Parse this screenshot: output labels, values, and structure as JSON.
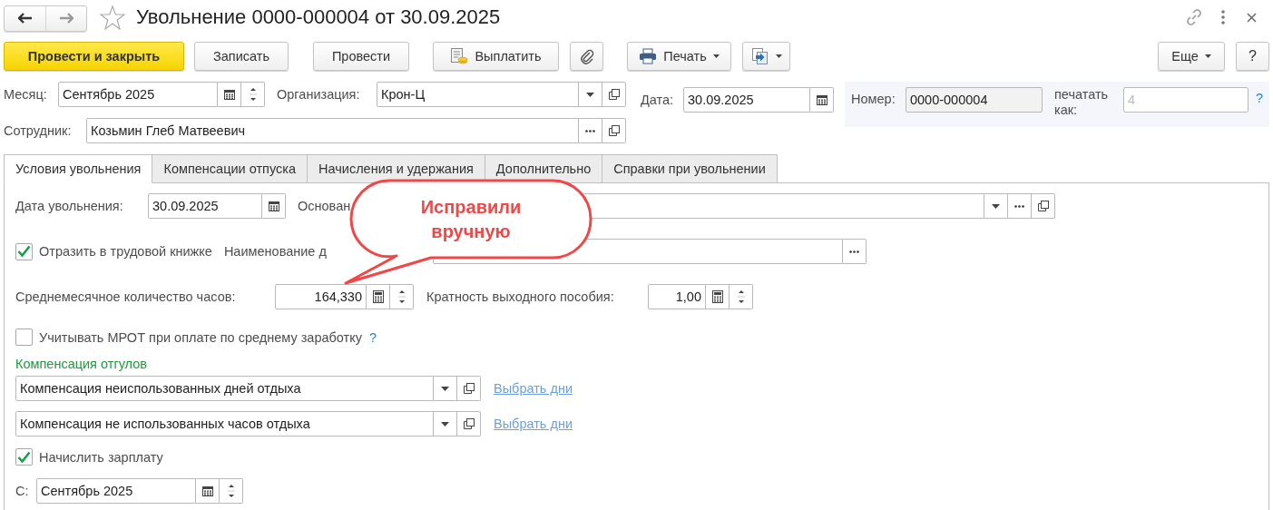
{
  "title": "Увольнение 0000-000004 от 30.09.2025",
  "toolbar_left": [
    {
      "kind": "primary",
      "label": "Провести и закрыть",
      "dropdown": false
    },
    {
      "kind": "text",
      "label": "Записать",
      "dropdown": false
    },
    {
      "kind": "text",
      "label": "Провести",
      "dropdown": false
    },
    {
      "kind": "pay",
      "label": "Выплатить",
      "dropdown": false
    },
    {
      "kind": "attach",
      "dropdown": false
    },
    {
      "kind": "print",
      "label": "Печать",
      "dropdown": true
    },
    {
      "kind": "export",
      "dropdown": true
    }
  ],
  "toolbar_right": [
    {
      "kind": "text",
      "label": "Еще",
      "dropdown": true
    },
    {
      "kind": "help",
      "label": "?",
      "dropdown": false
    }
  ],
  "month": {
    "label": "Месяц:",
    "value": "Сентябрь 2025",
    "buttons": [
      {
        "kind": "calendar"
      },
      {
        "kind": "spin"
      }
    ]
  },
  "organization": {
    "label": "Организация:",
    "value": "Крон-Ц",
    "buttons": [
      {
        "kind": "dropdown"
      },
      {
        "kind": "open"
      }
    ]
  },
  "employee": {
    "label": "Сотрудник:",
    "value": "Козьмин Глеб Матвеевич",
    "buttons": [
      {
        "kind": "select"
      },
      {
        "kind": "open"
      }
    ]
  },
  "date": {
    "label": "Дата:",
    "value": "30.09.2025",
    "buttons": [
      {
        "kind": "calendar"
      }
    ]
  },
  "number": {
    "label": "Номер:",
    "value": "0000-000004",
    "readonly": true
  },
  "print_as": {
    "label": "печатать как:",
    "placeholder": "4",
    "hint": "?"
  },
  "tabs": [
    {
      "label": "Условия увольнения",
      "selected": true
    },
    {
      "label": "Компенсации отпуска",
      "selected": false
    },
    {
      "label": "Начисления и удержания",
      "selected": false
    },
    {
      "label": "Дополнительно",
      "selected": false
    },
    {
      "label": "Справки при увольнении",
      "selected": false
    }
  ],
  "dismissal_date": {
    "label": "Дата увольнения:",
    "value": "30.09.2025",
    "buttons": [
      {
        "kind": "calendar"
      }
    ]
  },
  "basis": {
    "label": "Основан",
    "buttons": [
      {
        "kind": "dropdown"
      },
      {
        "kind": "select"
      },
      {
        "kind": "open"
      }
    ]
  },
  "work_book": {
    "label": "Отразить в трудовой книжке",
    "checked": true
  },
  "document_name": {
    "label": "Наименование д",
    "buttons": [
      {
        "kind": "select"
      }
    ]
  },
  "avg_hours": {
    "label": "Среднемесячное количество часов:",
    "value": "164,330",
    "buttons": [
      {
        "kind": "calc"
      },
      {
        "kind": "spin"
      }
    ]
  },
  "severance": {
    "label": "Кратность выходного пособия:",
    "value": "1,00",
    "buttons": [
      {
        "kind": "calc"
      },
      {
        "kind": "spin"
      }
    ]
  },
  "mrot": {
    "label": "Учитывать МРОТ при оплате по среднему заработку",
    "checked": false,
    "hint": "?"
  },
  "compensation": {
    "title": "Компенсация отгулов",
    "rows": [
      {
        "value": "Компенсация неиспользованных дней отдыха",
        "buttons": [
          {
            "kind": "dropdown"
          },
          {
            "kind": "open"
          }
        ],
        "link": "Выбрать дни"
      },
      {
        "value": "Компенсация не использованных часов отдыха",
        "buttons": [
          {
            "kind": "dropdown"
          },
          {
            "kind": "open"
          }
        ],
        "link": "Выбрать дни"
      }
    ]
  },
  "accrue": {
    "label": "Начислить зарплату",
    "checked": true
  },
  "from": {
    "label": "С:",
    "value": "Сентябрь 2025",
    "buttons": [
      {
        "kind": "calendar"
      },
      {
        "kind": "spin"
      }
    ]
  },
  "callout": {
    "text": "Исправили вручную"
  }
}
